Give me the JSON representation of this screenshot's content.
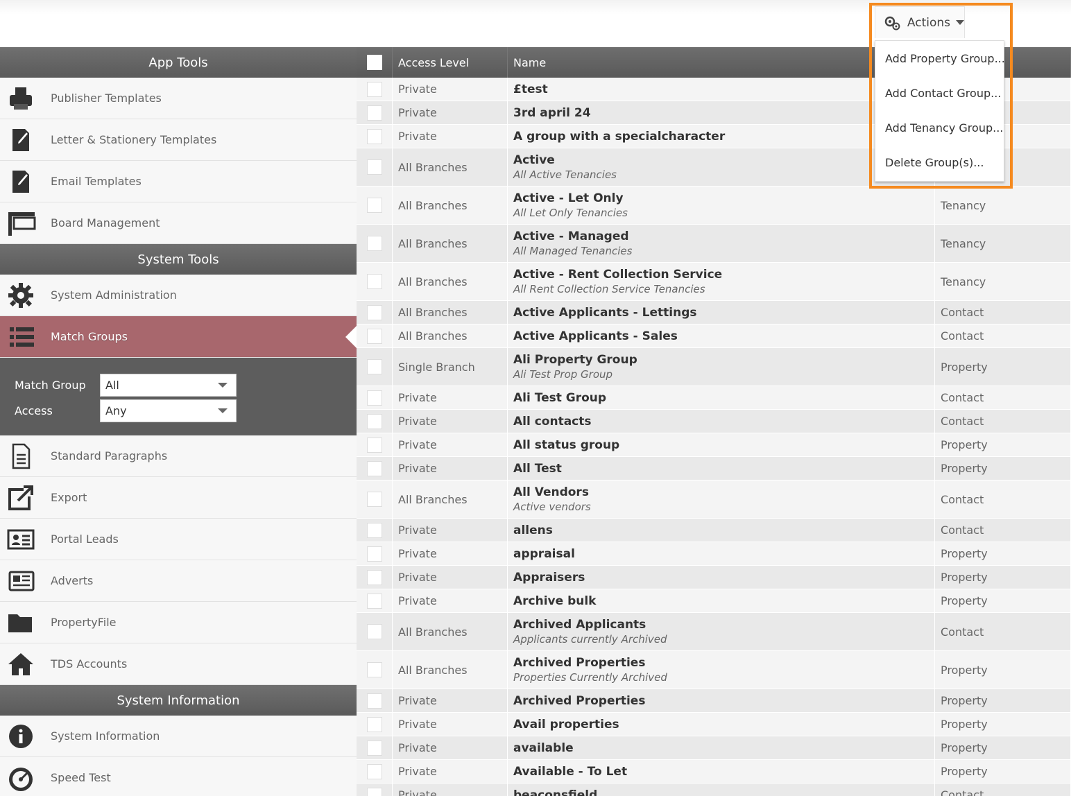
{
  "actions": {
    "label": "Actions",
    "menu": [
      "Add Property Group...",
      "Add Contact Group...",
      "Add Tenancy Group...",
      "Delete Group(s)..."
    ]
  },
  "sidebar": {
    "sections": [
      {
        "header": "App Tools",
        "items": [
          {
            "label": "Publisher Templates",
            "icon": "printer-icon"
          },
          {
            "label": "Letter & Stationery Templates",
            "icon": "document-edit-icon"
          },
          {
            "label": "Email Templates",
            "icon": "document-edit-icon"
          },
          {
            "label": "Board Management",
            "icon": "board-icon"
          }
        ]
      },
      {
        "header": "System Tools",
        "items": [
          {
            "label": "System Administration",
            "icon": "gear-icon"
          },
          {
            "label": "Match Groups",
            "icon": "list-icon",
            "active": true
          }
        ]
      },
      {
        "header": "",
        "items": [
          {
            "label": "Standard Paragraphs",
            "icon": "paragraph-icon"
          },
          {
            "label": "Export",
            "icon": "export-icon"
          },
          {
            "label": "Portal Leads",
            "icon": "contact-card-icon"
          },
          {
            "label": "Adverts",
            "icon": "newspaper-icon"
          },
          {
            "label": "PropertyFile",
            "icon": "folder-icon"
          },
          {
            "label": "TDS Accounts",
            "icon": "house-icon"
          }
        ]
      },
      {
        "header": "System Information",
        "items": [
          {
            "label": "System Information",
            "icon": "info-icon"
          },
          {
            "label": "Speed Test",
            "icon": "gauge-icon"
          }
        ]
      }
    ],
    "filters": {
      "match_group_label": "Match Group",
      "match_group_value": "All",
      "access_label": "Access",
      "access_value": "Any"
    }
  },
  "table": {
    "headers": {
      "access": "Access Level",
      "name": "Name",
      "type": ""
    },
    "rows": [
      {
        "access": "Private",
        "name": "£test",
        "desc": "",
        "type": ""
      },
      {
        "access": "Private",
        "name": "3rd april 24",
        "desc": "",
        "type": ""
      },
      {
        "access": "Private",
        "name": "A group with a specialcharacter",
        "desc": "",
        "type": ""
      },
      {
        "access": "All Branches",
        "name": "Active",
        "desc": "All Active Tenancies",
        "type": ""
      },
      {
        "access": "All Branches",
        "name": "Active - Let Only",
        "desc": "All Let Only Tenancies",
        "type": "Tenancy"
      },
      {
        "access": "All Branches",
        "name": "Active - Managed",
        "desc": "All Managed Tenancies",
        "type": "Tenancy"
      },
      {
        "access": "All Branches",
        "name": "Active - Rent Collection Service",
        "desc": "All Rent Collection Service Tenancies",
        "type": "Tenancy"
      },
      {
        "access": "All Branches",
        "name": "Active Applicants - Lettings",
        "desc": "",
        "type": "Contact"
      },
      {
        "access": "All Branches",
        "name": "Active Applicants - Sales",
        "desc": "",
        "type": "Contact"
      },
      {
        "access": "Single Branch",
        "name": "Ali Property Group",
        "desc": "Ali Test Prop Group",
        "type": "Property"
      },
      {
        "access": "Private",
        "name": "Ali Test Group",
        "desc": "",
        "type": "Contact"
      },
      {
        "access": "Private",
        "name": "All contacts",
        "desc": "",
        "type": "Contact"
      },
      {
        "access": "Private",
        "name": "All status group",
        "desc": "",
        "type": "Property"
      },
      {
        "access": "Private",
        "name": "All Test",
        "desc": "",
        "type": "Property"
      },
      {
        "access": "All Branches",
        "name": "All Vendors",
        "desc": "Active vendors",
        "type": "Contact"
      },
      {
        "access": "Private",
        "name": "allens",
        "desc": "",
        "type": "Contact"
      },
      {
        "access": "Private",
        "name": "appraisal",
        "desc": "",
        "type": "Property"
      },
      {
        "access": "Private",
        "name": "Appraisers",
        "desc": "",
        "type": "Property"
      },
      {
        "access": "Private",
        "name": "Archive bulk",
        "desc": "",
        "type": "Property"
      },
      {
        "access": "All Branches",
        "name": "Archived Applicants",
        "desc": "Applicants currently Archived",
        "type": "Contact"
      },
      {
        "access": "All Branches",
        "name": "Archived Properties",
        "desc": "Properties Currently Archived",
        "type": "Property"
      },
      {
        "access": "Private",
        "name": "Archived Properties",
        "desc": "",
        "type": "Property"
      },
      {
        "access": "Private",
        "name": "Avail properties",
        "desc": "",
        "type": "Property"
      },
      {
        "access": "Private",
        "name": "available",
        "desc": "",
        "type": "Property"
      },
      {
        "access": "Private",
        "name": "Available - To Let",
        "desc": "",
        "type": "Property"
      },
      {
        "access": "Private",
        "name": "beaconsfield",
        "desc": "",
        "type": "Contact"
      }
    ]
  }
}
